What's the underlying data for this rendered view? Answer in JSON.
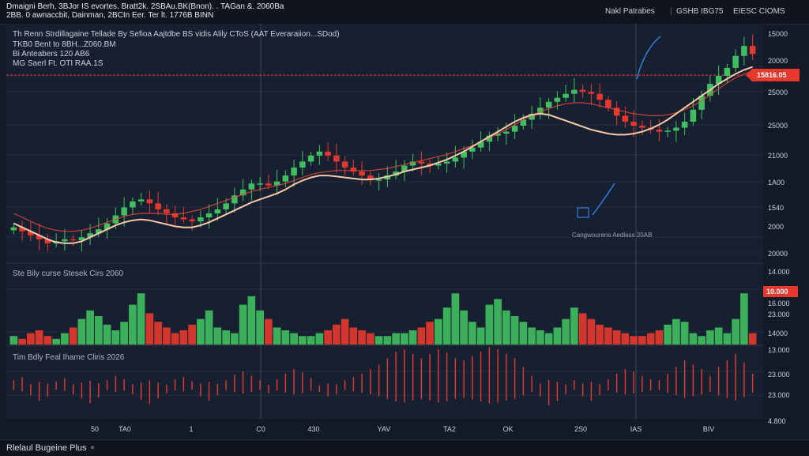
{
  "header": {
    "line1": "Dmaigni Berh, 3BJor IS evortes. Bratt2k. 2SBAu.BK(Bnon). . TAGan &. 2060Ba",
    "line2": "2BB. 0 awnaccbit, Dainman, 2BCIn Eer. Ter lt. 1776B BINN",
    "right_a": "Nakl Patrabes",
    "right_b": "GSHB IBG75",
    "right_c": "EIESC CIOMS"
  },
  "chart_data": {
    "type": "candlestick",
    "title": "",
    "xlabel": "",
    "ylabel": "",
    "x_ticks": [
      "50",
      "TA0",
      "1",
      "C0",
      "430",
      "YAV",
      "TA2",
      "OK",
      "2S0",
      "IAS",
      "BIV"
    ],
    "price_ticks": [
      "15000",
      "20000",
      "25000",
      "25000",
      "21000",
      "1A00",
      "1540",
      "2000",
      "20000"
    ],
    "volume_ticks": [
      "14.000",
      "16.000",
      "23.000",
      "14000"
    ],
    "oscillator_ticks": [
      "13.000",
      "23.000",
      "23.000",
      "4.800"
    ],
    "current_price_label": "15816.05",
    "volume_marker_label": "10.000",
    "overlay": {
      "line1": "Th Renn Strdillagaine Tellade By Sefioa Aajtdbe BS vidis Alily CToS (AAT Everaraiion...SDod)",
      "line2": "TKB0 Bent to 8BH...Z060.BM",
      "line3": "Bi Anteabers  120 AB6",
      "line4": "MG Saerl Ft. OTI RAA.1S"
    },
    "annotation": "Cangwourens Aedlass 20AB",
    "volume_panel_title": "Ste Bily curse Stesek Cirs 2060",
    "oscillator_panel_title": "Tim Bdly Feal Ihame Cliris 2026",
    "close_series": [
      11.2,
      10.8,
      10.4,
      10.0,
      9.6,
      9.8,
      10.0,
      9.9,
      10.2,
      10.6,
      11.0,
      11.6,
      12.4,
      13.2,
      13.8,
      14.0,
      13.6,
      13.0,
      12.6,
      12.2,
      12.0,
      11.8,
      12.2,
      12.6,
      13.0,
      13.6,
      14.4,
      15.0,
      15.6,
      15.6,
      15.4,
      15.8,
      16.4,
      17.2,
      17.8,
      18.4,
      18.8,
      18.4,
      17.8,
      17.2,
      16.8,
      16.4,
      16.0,
      16.0,
      16.4,
      16.8,
      17.4,
      17.8,
      17.6,
      17.4,
      17.6,
      17.8,
      18.2,
      18.8,
      19.2,
      19.8,
      20.4,
      20.6,
      20.8,
      21.4,
      22.0,
      22.6,
      23.2,
      23.8,
      24.2,
      24.6,
      25.0,
      24.8,
      24.6,
      24.0,
      23.2,
      22.4,
      21.8,
      21.4,
      21.2,
      21.0,
      20.8,
      20.9,
      21.2,
      21.8,
      23.0,
      24.4,
      25.6,
      26.4,
      27.2,
      28.4,
      29.4,
      28.6
    ],
    "ma_fast": [
      12.6,
      12.2,
      11.8,
      11.4,
      11.1,
      10.9,
      10.8,
      10.8,
      10.9,
      11.1,
      11.4,
      11.7,
      12.0,
      12.3,
      12.5,
      12.6,
      12.6,
      12.6,
      12.5,
      12.5,
      12.6,
      12.8,
      13.0,
      13.3,
      13.6,
      13.9,
      14.2,
      14.5,
      14.8,
      15.0,
      15.2,
      15.4,
      15.6,
      15.9,
      16.2,
      16.5,
      16.7,
      16.8,
      16.9,
      16.9,
      16.9,
      16.9,
      16.9,
      17.0,
      17.1,
      17.3,
      17.5,
      17.7,
      17.9,
      18.1,
      18.3,
      18.5,
      18.8,
      19.1,
      19.4,
      19.8,
      20.2,
      20.6,
      21.0,
      21.5,
      22.0,
      22.4,
      22.8,
      23.1,
      23.4,
      23.6,
      23.7,
      23.7,
      23.6,
      23.4,
      23.2,
      23.0,
      22.8,
      22.6,
      22.5,
      22.4,
      22.4,
      22.5,
      22.7,
      23.0,
      23.4,
      23.9,
      24.5,
      25.1,
      25.7,
      26.2,
      26.6,
      26.9
    ],
    "ma_slow": [
      11.6,
      11.2,
      10.8,
      10.4,
      10.0,
      9.7,
      9.6,
      9.6,
      9.8,
      10.2,
      10.6,
      11.0,
      11.4,
      11.7,
      11.9,
      12.0,
      11.9,
      11.7,
      11.5,
      11.3,
      11.2,
      11.2,
      11.4,
      11.7,
      12.1,
      12.5,
      12.9,
      13.3,
      13.7,
      14.0,
      14.3,
      14.6,
      15.0,
      15.5,
      15.9,
      16.2,
      16.4,
      16.4,
      16.3,
      16.2,
      16.1,
      16.0,
      16.0,
      16.1,
      16.3,
      16.5,
      16.8,
      17.0,
      17.2,
      17.4,
      17.7,
      18.0,
      18.4,
      18.8,
      19.3,
      19.8,
      20.3,
      20.8,
      21.3,
      21.8,
      22.2,
      22.5,
      22.6,
      22.5,
      22.2,
      21.9,
      21.6,
      21.3,
      21.0,
      20.8,
      20.6,
      20.5,
      20.5,
      20.6,
      20.8,
      21.1,
      21.5,
      22.0,
      22.6,
      23.2,
      23.8,
      24.4,
      25.0,
      25.6,
      26.1,
      26.6,
      27.0,
      27.3
    ],
    "volume": [
      3,
      2,
      4,
      5,
      3,
      2,
      4,
      6,
      9,
      12,
      10,
      7,
      5,
      8,
      14,
      18,
      11,
      8,
      6,
      4,
      5,
      7,
      9,
      12,
      6,
      5,
      4,
      14,
      17,
      12,
      9,
      6,
      5,
      4,
      3,
      3,
      4,
      5,
      7,
      9,
      6,
      5,
      4,
      3,
      3,
      4,
      4,
      5,
      6,
      8,
      9,
      13,
      18,
      12,
      8,
      6,
      14,
      16,
      12,
      10,
      8,
      6,
      5,
      4,
      6,
      9,
      13,
      11,
      9,
      7,
      6,
      5,
      4,
      3,
      3,
      4,
      5,
      7,
      9,
      8,
      4,
      3,
      5,
      6,
      4,
      9,
      18,
      4
    ],
    "oscillator": [
      0.2,
      0.5,
      -0.3,
      -0.8,
      -0.4,
      0.1,
      0.4,
      -0.2,
      -0.6,
      -1.0,
      -0.5,
      0.2,
      0.6,
      0.3,
      -0.2,
      -0.7,
      -1.1,
      -0.6,
      -0.1,
      0.3,
      0.5,
      0.1,
      -0.4,
      -0.8,
      -0.3,
      0.2,
      0.7,
      1.0,
      0.6,
      0.2,
      -0.1,
      0.3,
      0.8,
      1.2,
      0.9,
      0.4,
      0.0,
      -0.4,
      -0.2,
      0.2,
      0.5,
      0.8,
      1.2,
      1.6,
      2.2,
      2.8,
      3.0,
      2.6,
      2.2,
      2.6,
      3.0,
      2.7,
      2.2,
      2.0,
      2.4,
      2.8,
      3.2,
      3.0,
      2.6,
      2.2,
      1.4,
      0.6,
      -0.4,
      -1.2,
      -0.8,
      -0.2,
      0.2,
      -0.4,
      -0.8,
      -0.3,
      0.3,
      0.8,
      1.2,
      1.0,
      0.6,
      0.3,
      0.2,
      0.8,
      1.4,
      2.0,
      1.6,
      1.2,
      0.6,
      1.4,
      2.0,
      2.6,
      1.8,
      0.8
    ],
    "colors": {
      "up": "#3fbf5f",
      "down": "#e8382d",
      "ma_fast": "#e8483c",
      "ma_slow": "#f7c9a8",
      "price_line": "#e8382d",
      "blue": "#2f7fe0",
      "grid": "#232c3c"
    },
    "grid": true
  },
  "footer": {
    "label": "Rlelaul Bugeine Plus"
  }
}
